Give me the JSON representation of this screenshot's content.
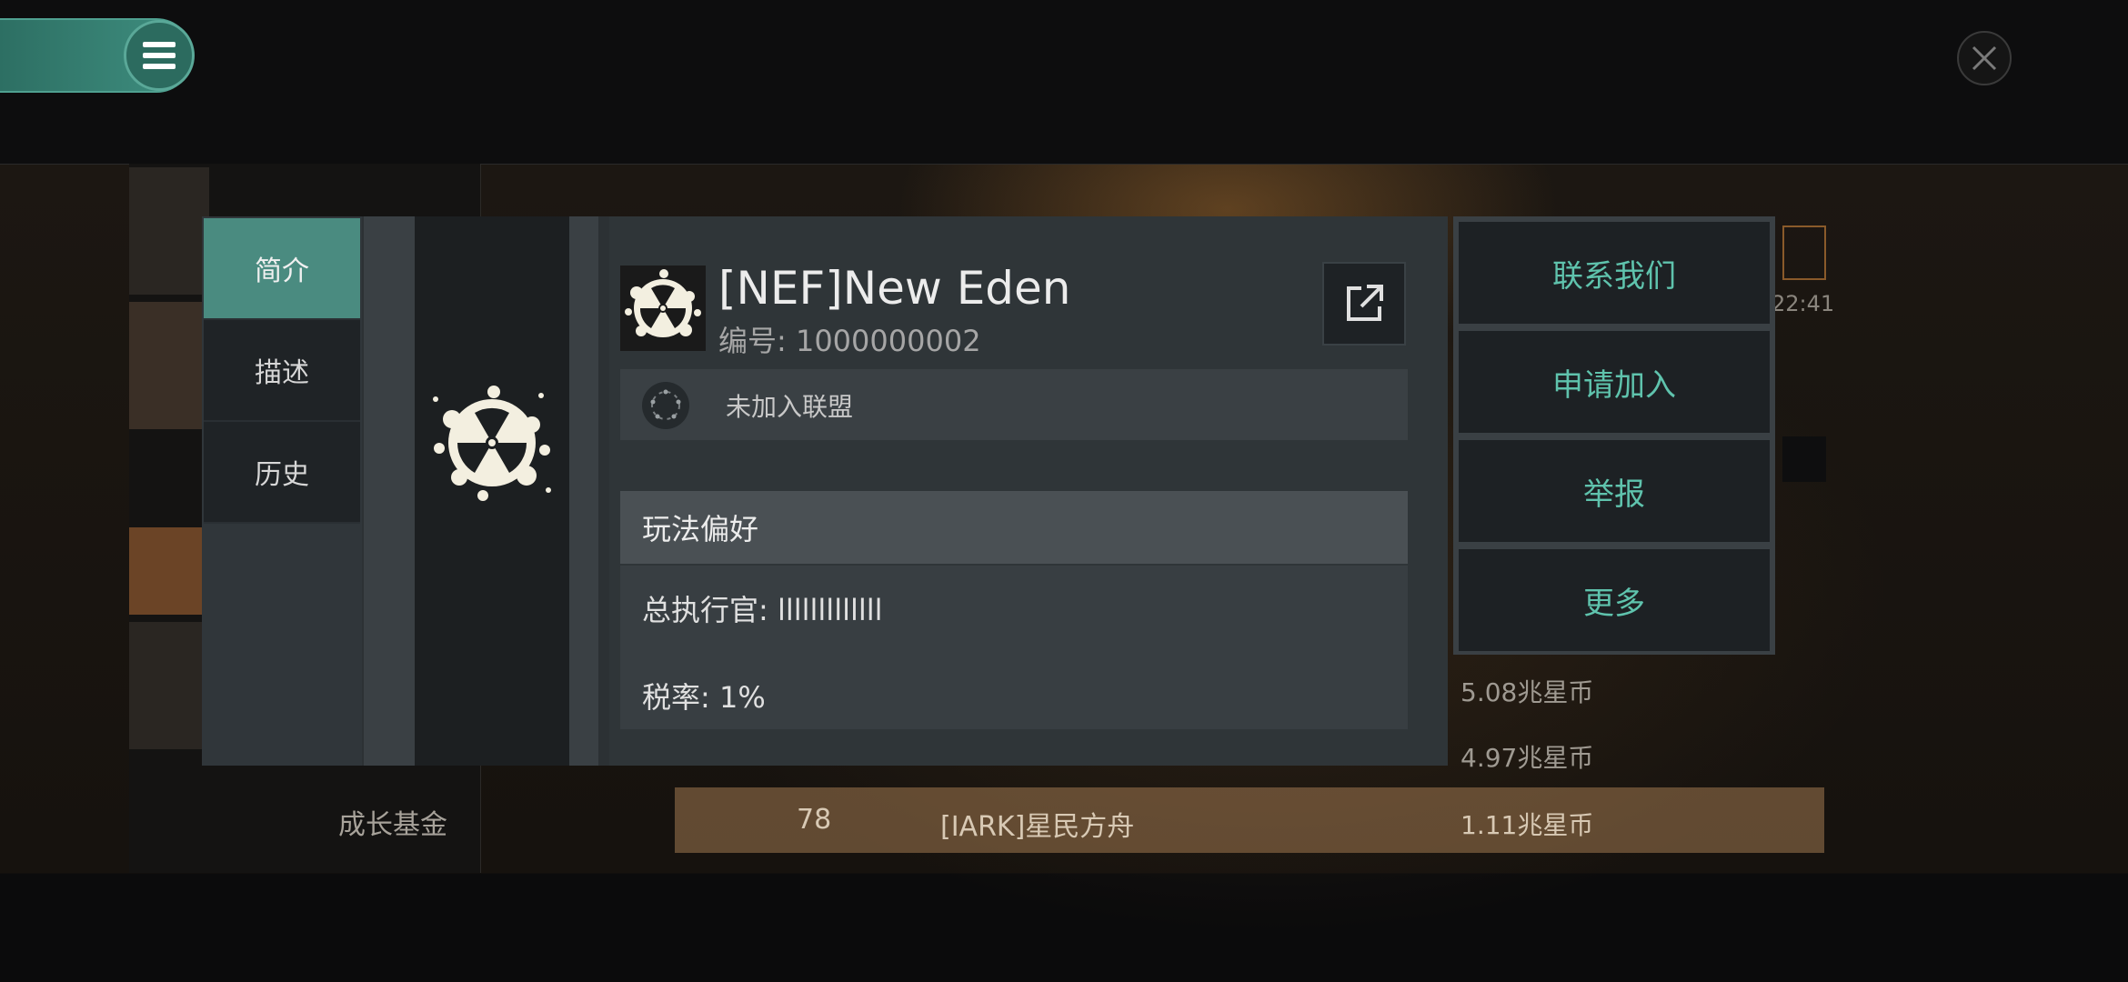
{
  "background": {
    "growth_fund_label": "成长基金",
    "row_rank": "78",
    "row_name": "[IARK]星民方舟",
    "values": [
      "5.08兆星币",
      "4.97兆星币",
      "1.11兆星币"
    ],
    "time_fragment": "22:41"
  },
  "tabs": [
    {
      "label": "简介",
      "active": true
    },
    {
      "label": "描述",
      "active": false
    },
    {
      "label": "历史",
      "active": false
    }
  ],
  "corp": {
    "name": "[NEF]New Eden",
    "id_line": "编号: 1000000002",
    "alliance_status": "未加入联盟",
    "preferences_title": "玩法偏好",
    "ceo_line": "总执行官: lllllllllllll",
    "tax_line": "税率: 1%"
  },
  "actions": [
    {
      "label": "联系我们"
    },
    {
      "label": "申请加入"
    },
    {
      "label": "举报"
    },
    {
      "label": "更多"
    }
  ],
  "colors": {
    "accent": "#5fc3ad",
    "active_tab": "#4a8b80",
    "menu_pill": "#3f8f80"
  },
  "icons": {
    "menu": "menu-icon",
    "close": "close-icon",
    "emblem": "radiation-splat-icon",
    "external": "external-link-icon",
    "alliance": "alliance-stars-icon"
  }
}
